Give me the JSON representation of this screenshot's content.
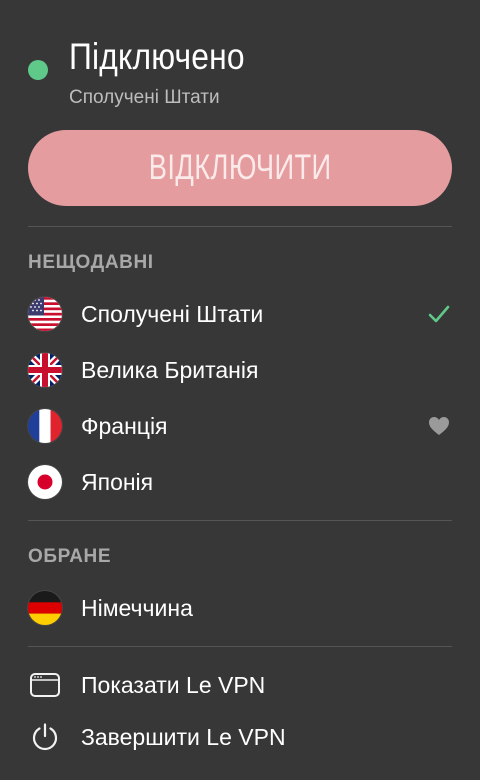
{
  "status": {
    "title": "Підключено",
    "location": "Сполучені Штати",
    "dot_color": "#5fc98a"
  },
  "disconnect_button": {
    "label": "ВІДКЛЮЧИТИ",
    "color": "#e59c9f"
  },
  "recent": {
    "header": "НЕЩОДАВНІ",
    "items": [
      {
        "label": "Сполучені Штати",
        "flag": "us-flag-icon",
        "trailing": "checkmark-icon"
      },
      {
        "label": "Велика Британія",
        "flag": "uk-flag-icon",
        "trailing": ""
      },
      {
        "label": "Франція",
        "flag": "france-flag-icon",
        "trailing": "heart-icon"
      },
      {
        "label": "Японія",
        "flag": "japan-flag-icon",
        "trailing": ""
      }
    ]
  },
  "favorites": {
    "header": "ОБРАНЕ",
    "items": [
      {
        "label": "Німеччина",
        "flag": "germany-flag-icon"
      }
    ]
  },
  "actions": {
    "show": {
      "label": "Показати Le VPN",
      "icon": "window-icon"
    },
    "quit": {
      "label": "Завершити Le VPN",
      "icon": "power-icon"
    }
  },
  "colors": {
    "background": "#373737",
    "check": "#5fc98a",
    "heart": "#9a9a9a"
  }
}
